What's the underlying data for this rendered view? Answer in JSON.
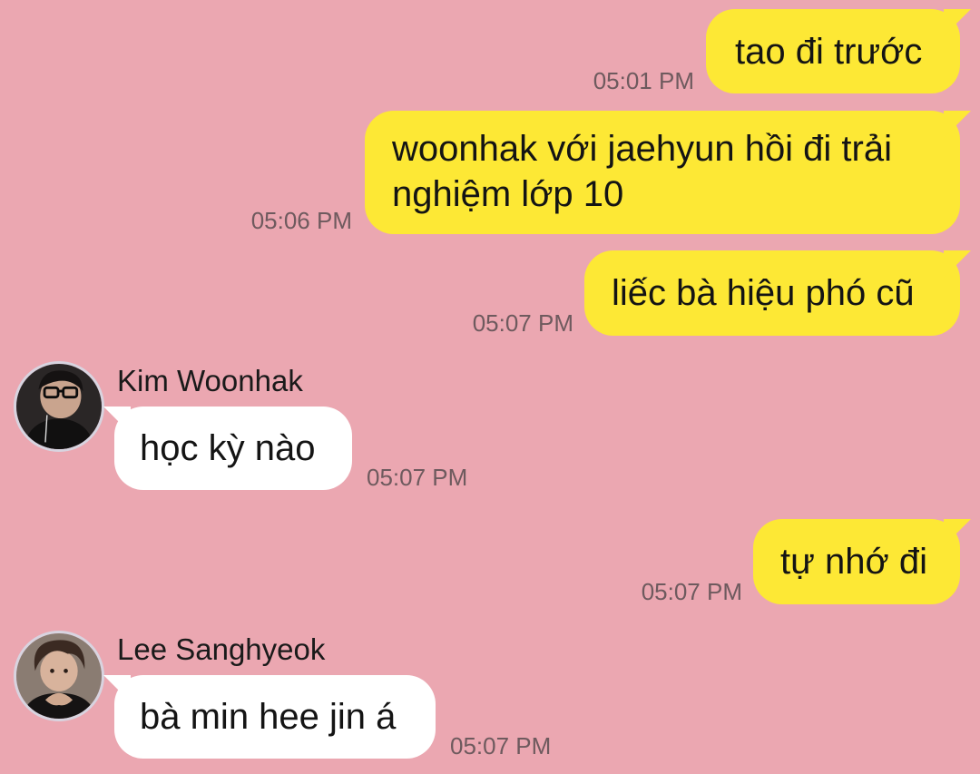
{
  "chat": {
    "messages": [
      {
        "direction": "outgoing",
        "text": "tao đi trước",
        "time": "05:01 PM"
      },
      {
        "direction": "outgoing",
        "text": "woonhak với jaehyun hồi đi trải nghiệm lớp 10",
        "time": "05:06 PM"
      },
      {
        "direction": "outgoing",
        "text": "liếc bà hiệu phó cũ",
        "time": "05:07 PM"
      },
      {
        "direction": "incoming",
        "sender": "Kim Woonhak",
        "avatar": "avatar-kim-woonhak",
        "text": "học kỳ nào",
        "time": "05:07 PM"
      },
      {
        "direction": "outgoing",
        "text": "tự nhớ đi",
        "time": "05:07 PM"
      },
      {
        "direction": "incoming",
        "sender": "Lee Sanghyeok",
        "avatar": "avatar-lee-sanghyeok",
        "text": "bà min hee jin á",
        "time": "05:07 PM"
      }
    ]
  },
  "colors": {
    "background": "#EBA7B1",
    "outgoing_bubble": "#FDE835",
    "incoming_bubble": "#FFFFFF",
    "timestamp": "#6E5A5E"
  }
}
